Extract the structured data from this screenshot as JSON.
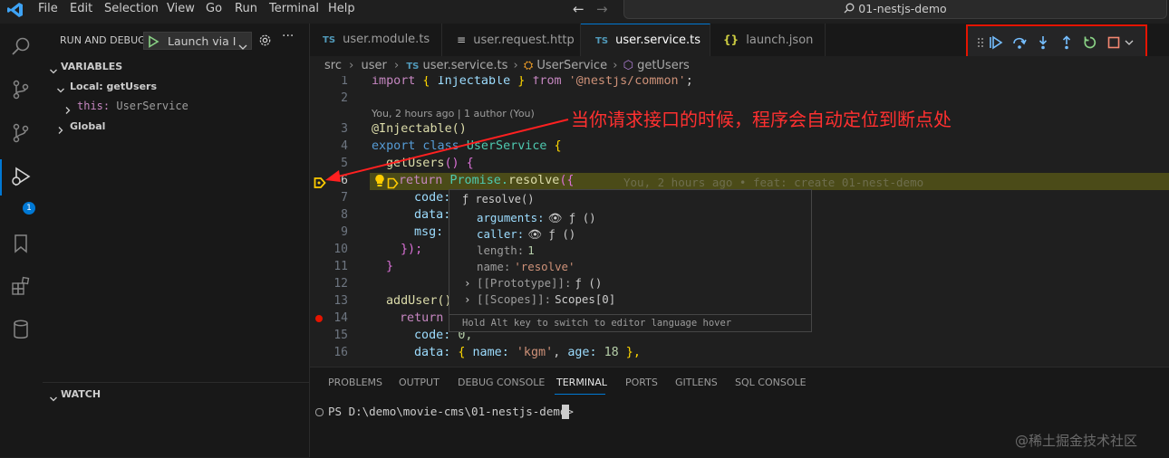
{
  "menu": [
    "File",
    "Edit",
    "Selection",
    "View",
    "Go",
    "Run",
    "Terminal",
    "Help"
  ],
  "command_center": "01-nestjs-demo",
  "sidebar": {
    "title": "RUN AND DEBUG",
    "launch_config": "Launch via I",
    "variables_header": "VARIABLES",
    "local_scope": "Local: getUsers",
    "this_name": "this:",
    "this_value": "UserService",
    "global_scope": "Global",
    "watch_header": "WATCH",
    "debug_badge": "1"
  },
  "tabs": [
    {
      "badge": "TS",
      "label": "user.module.ts"
    },
    {
      "badge": "≡",
      "label": "user.request.http"
    },
    {
      "badge": "TS",
      "label": "user.service.ts",
      "close": "×"
    },
    {
      "badge": "{}",
      "label": "launch.json"
    }
  ],
  "breadcrumb": {
    "items": [
      "src",
      "user",
      "user.service.ts",
      "UserService",
      "getUsers"
    ],
    "file_badge": "TS"
  },
  "editor": {
    "line_numbers": [
      "1",
      "2",
      "3",
      "4",
      "5",
      "6",
      "7",
      "8",
      "9",
      "10",
      "11",
      "12",
      "13",
      "14",
      "15",
      "16"
    ],
    "codelens": "You, 2 hours ago | 1 author (You)",
    "inline_blame": "You, 2 hours ago • feat: create 01-nest-demo",
    "annotation": "当你请求接口的时候，程序会自动定位到断点处",
    "code": {
      "l1_import": "import",
      "l1_brace_open": " { ",
      "l1_injectable": "Injectable",
      "l1_brace_close": " } ",
      "l1_from": "from",
      "l1_module": " '@nestjs/common'",
      "l1_semicolon": ";",
      "l3": "@Injectable()",
      "l4_export": "export",
      "l4_class": " class ",
      "l4_name": "UserService",
      "l4_brace": " {",
      "l5_fn": "getUsers",
      "l5_rest": "() {",
      "l6_return": "return",
      "l6_promise": " Promise.",
      "l6_resolve": "resolve",
      "l6_rest": "({",
      "l7": "code:",
      "l8": "data:",
      "l9": "msg:",
      "l10": "});",
      "l11": "}",
      "l13_fn": "addUser()",
      "l14": "return",
      "l15_key": "code:",
      "l15_val": " 0,",
      "l16_key": "data:",
      "l16_p1": " { ",
      "l16_name": "name:",
      "l16_nameval": " 'kgm'",
      "l16_comma": ", ",
      "l16_age": "age:",
      "l16_ageval": " 18",
      "l16_end": " },"
    }
  },
  "hover": {
    "title": "ƒ resolve()",
    "rows": [
      {
        "key": "arguments:",
        "value": "👁 ƒ ()"
      },
      {
        "key": "caller:",
        "value": "👁 ƒ ()"
      },
      {
        "key": "length:",
        "value": "1"
      },
      {
        "key": "name:",
        "value": "'resolve'"
      },
      {
        "key": "[[Prototype]]:",
        "value": "ƒ ()"
      },
      {
        "key": "[[Scopes]]:",
        "value": "Scopes[0]"
      }
    ],
    "footer": "Hold Alt key to switch to editor language hover"
  },
  "panel": {
    "tabs": [
      "PROBLEMS",
      "OUTPUT",
      "DEBUG CONSOLE",
      "TERMINAL",
      "PORTS",
      "GITLENS",
      "SQL CONSOLE"
    ],
    "active_tab": "TERMINAL",
    "terminal_prompt": "PS D:\\demo\\movie-cms\\01-nestjs-demo>"
  },
  "watermark": "@稀土掘金技术社区",
  "colors": {
    "accent": "#0078d4",
    "highlight_line": "#4b4b18",
    "annotation": "#ff3030",
    "debug_orange": "#ffcc00"
  },
  "icons": [
    "vscode-logo-icon",
    "search-icon",
    "source-control-icon",
    "run-debug-icon",
    "bookmark-icon",
    "extensions-icon",
    "database-icon",
    "gear-icon",
    "more-icon",
    "play-icon"
  ]
}
